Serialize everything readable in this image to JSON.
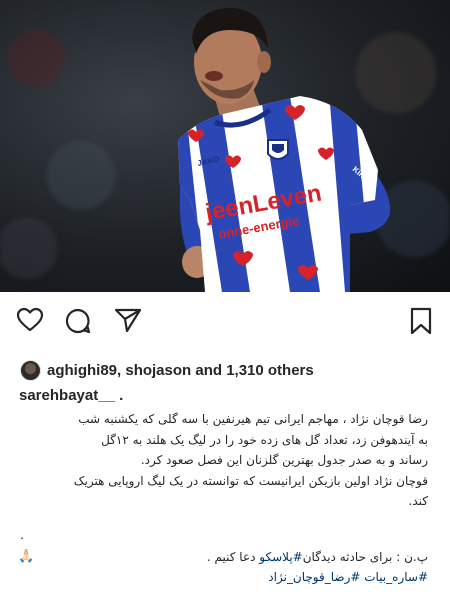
{
  "post": {
    "image_alt": "football player in blue and white striped jersey",
    "jersey": {
      "sponsor_main": "jeenLeven",
      "sponsor_sub": "onne-energie",
      "brand": "JAKO",
      "sleeve": "KingS"
    }
  },
  "actions": {
    "like": "heart-icon",
    "comment": "comment-icon",
    "share": "share-icon",
    "save": "bookmark-icon"
  },
  "likes": {
    "text": "aghighi89, shojason and 1,310 others"
  },
  "caption": {
    "author": "sarehbayat__ .",
    "lines": [
      "رضا قوچان نژاد ، مهاجم ایرانی تیم هیرنفین با سه گلی که یکشنبه شب",
      "به آیندهوفن زد، تعداد گل های زده خود را در لیگ یک هلند به ۱۲گل",
      "رساند و به صدر جدول بهترین گلزنان این فصل صعود کرد.",
      "قوچان نژاد اولین بازیکن ایرانیست که توانسته در یک لیگ اروپایی هتریک",
      "کند."
    ],
    "dot": ".",
    "ps_prefix": "پ.ن : برای حادثه دیدگان",
    "ps_tag": "#پلاسکو",
    "ps_suffix": " دعا کنیم .",
    "pray_emoji": "🙏🏻",
    "hashtags": "#ساره_بیات #رضا_قوچان_نژاد"
  },
  "colors": {
    "jersey_blue": "#2b47b5",
    "link_blue": "#003569",
    "heart_red": "#d8222a"
  }
}
